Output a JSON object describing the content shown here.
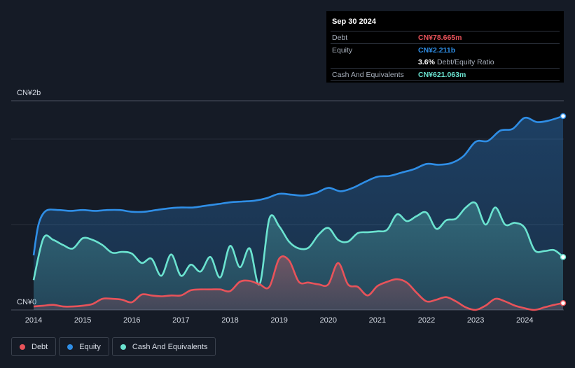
{
  "tooltip": {
    "date": "Sep 30 2024",
    "rows": [
      {
        "label": "Debt",
        "value": "CN¥78.665m",
        "color": "#e8535a"
      },
      {
        "label": "Equity",
        "value": "CN¥2.211b",
        "color": "#2f8ee6"
      },
      {
        "label": "",
        "value": "3.6%",
        "suffix": "Debt/Equity Ratio",
        "color": "#ffffff"
      },
      {
        "label": "Cash And Equivalents",
        "value": "CN¥621.063m",
        "color": "#6be3d0"
      }
    ]
  },
  "legend": [
    {
      "label": "Debt",
      "color": "#e8535a"
    },
    {
      "label": "Equity",
      "color": "#2f8ee6"
    },
    {
      "label": "Cash And Equivalents",
      "color": "#6be3d0"
    }
  ],
  "chart_data": {
    "type": "area",
    "y_top_label": "CN¥2b",
    "y_bottom_label": "CN¥0",
    "ylim": [
      0,
      2.45
    ],
    "xlim": [
      2014.0,
      2024.78
    ],
    "x_ticks": [
      "2014",
      "2015",
      "2016",
      "2017",
      "2018",
      "2019",
      "2020",
      "2021",
      "2022",
      "2023",
      "2024"
    ],
    "grid": true,
    "legend_position": "bottom-left",
    "series": [
      {
        "name": "Equity",
        "color": "#2f8ee6",
        "x": [
          2014.0,
          2014.1,
          2014.25,
          2014.5,
          2014.75,
          2015.0,
          2015.25,
          2015.5,
          2015.75,
          2016.0,
          2016.25,
          2016.5,
          2016.75,
          2017.0,
          2017.25,
          2017.5,
          2017.75,
          2018.0,
          2018.25,
          2018.5,
          2018.75,
          2019.0,
          2019.25,
          2019.5,
          2019.75,
          2020.0,
          2020.25,
          2020.5,
          2020.75,
          2021.0,
          2021.25,
          2021.5,
          2021.75,
          2022.0,
          2022.25,
          2022.5,
          2022.75,
          2023.0,
          2023.25,
          2023.5,
          2023.75,
          2024.0,
          2024.25,
          2024.5,
          2024.78
        ],
        "values": [
          0.64,
          1.0,
          1.16,
          1.17,
          1.16,
          1.17,
          1.16,
          1.17,
          1.17,
          1.15,
          1.15,
          1.17,
          1.19,
          1.2,
          1.2,
          1.22,
          1.24,
          1.26,
          1.27,
          1.28,
          1.31,
          1.36,
          1.35,
          1.34,
          1.37,
          1.43,
          1.39,
          1.43,
          1.5,
          1.56,
          1.57,
          1.61,
          1.65,
          1.71,
          1.7,
          1.72,
          1.8,
          1.97,
          1.98,
          2.1,
          2.12,
          2.25,
          2.2,
          2.22,
          2.27
        ]
      },
      {
        "name": "Cash And Equivalents",
        "color": "#6be3d0",
        "x": [
          2014.0,
          2014.2,
          2014.4,
          2014.6,
          2014.8,
          2015.0,
          2015.2,
          2015.4,
          2015.6,
          2015.8,
          2016.0,
          2016.2,
          2016.4,
          2016.6,
          2016.8,
          2017.0,
          2017.2,
          2017.4,
          2017.6,
          2017.8,
          2018.0,
          2018.2,
          2018.4,
          2018.6,
          2018.8,
          2019.0,
          2019.2,
          2019.4,
          2019.6,
          2019.8,
          2020.0,
          2020.2,
          2020.4,
          2020.6,
          2020.8,
          2021.0,
          2021.2,
          2021.4,
          2021.6,
          2021.8,
          2022.0,
          2022.2,
          2022.4,
          2022.6,
          2022.8,
          2023.0,
          2023.2,
          2023.4,
          2023.6,
          2023.8,
          2024.0,
          2024.2,
          2024.4,
          2024.6,
          2024.78
        ],
        "values": [
          0.35,
          0.84,
          0.82,
          0.76,
          0.72,
          0.84,
          0.82,
          0.76,
          0.67,
          0.68,
          0.66,
          0.55,
          0.6,
          0.4,
          0.65,
          0.4,
          0.53,
          0.45,
          0.62,
          0.38,
          0.75,
          0.5,
          0.72,
          0.3,
          1.07,
          0.98,
          0.8,
          0.72,
          0.73,
          0.88,
          0.96,
          0.82,
          0.8,
          0.9,
          0.91,
          0.92,
          0.94,
          1.12,
          1.04,
          1.1,
          1.14,
          0.95,
          1.05,
          1.07,
          1.2,
          1.25,
          1.0,
          1.2,
          1.0,
          1.02,
          0.96,
          0.7,
          0.69,
          0.7,
          0.62
        ]
      },
      {
        "name": "Debt",
        "color": "#e8535a",
        "x": [
          2014.0,
          2014.2,
          2014.4,
          2014.6,
          2014.8,
          2015.0,
          2015.2,
          2015.4,
          2015.6,
          2015.8,
          2016.0,
          2016.2,
          2016.4,
          2016.6,
          2016.8,
          2017.0,
          2017.2,
          2017.4,
          2017.6,
          2017.8,
          2018.0,
          2018.2,
          2018.4,
          2018.6,
          2018.8,
          2019.0,
          2019.2,
          2019.4,
          2019.6,
          2019.8,
          2020.0,
          2020.2,
          2020.4,
          2020.6,
          2020.8,
          2021.0,
          2021.2,
          2021.4,
          2021.6,
          2021.8,
          2022.0,
          2022.2,
          2022.4,
          2022.6,
          2022.8,
          2023.0,
          2023.2,
          2023.4,
          2023.6,
          2023.8,
          2024.0,
          2024.2,
          2024.4,
          2024.6,
          2024.78
        ],
        "values": [
          0.04,
          0.05,
          0.06,
          0.04,
          0.04,
          0.05,
          0.07,
          0.13,
          0.13,
          0.12,
          0.09,
          0.18,
          0.17,
          0.16,
          0.17,
          0.17,
          0.23,
          0.24,
          0.24,
          0.24,
          0.22,
          0.33,
          0.34,
          0.3,
          0.27,
          0.6,
          0.58,
          0.33,
          0.32,
          0.3,
          0.3,
          0.55,
          0.3,
          0.27,
          0.17,
          0.28,
          0.33,
          0.36,
          0.32,
          0.2,
          0.1,
          0.12,
          0.15,
          0.1,
          0.03,
          0.0,
          0.05,
          0.13,
          0.1,
          0.05,
          0.02,
          0.0,
          0.03,
          0.06,
          0.08
        ]
      }
    ]
  }
}
